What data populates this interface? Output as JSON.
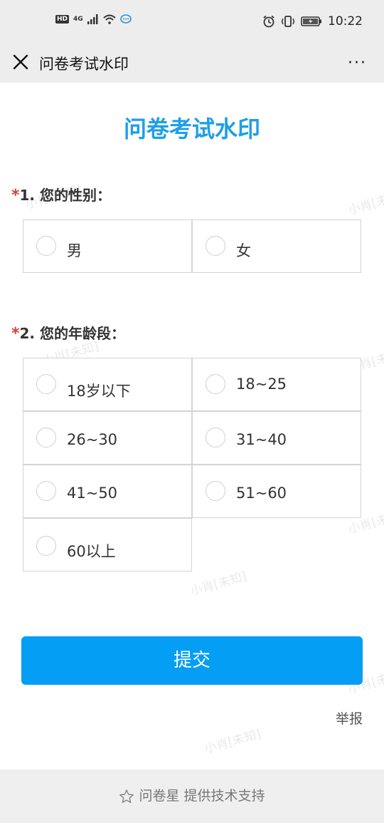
{
  "status_bar": {
    "time": "10:22",
    "hd": "HD",
    "network": "4G"
  },
  "nav": {
    "title": "问卷考试水印",
    "more": "···"
  },
  "page": {
    "title": "问卷考试水印"
  },
  "questions": [
    {
      "required_mark": "*",
      "label": "1. 您的性别：",
      "options": [
        "男",
        "女"
      ]
    },
    {
      "required_mark": "*",
      "label": "2. 您的年龄段：",
      "options": [
        "18岁以下",
        "18~25",
        "26~30",
        "31~40",
        "41~50",
        "51~60",
        "60以上"
      ]
    }
  ],
  "actions": {
    "submit_label": "提交",
    "report_label": "举报"
  },
  "footer": {
    "text": "问卷星 提供技术支持"
  },
  "watermark": {
    "text": "小肖[未知]"
  },
  "colors": {
    "accent": "#1e9fe8",
    "button": "#049ef4",
    "required": "#e53935"
  }
}
